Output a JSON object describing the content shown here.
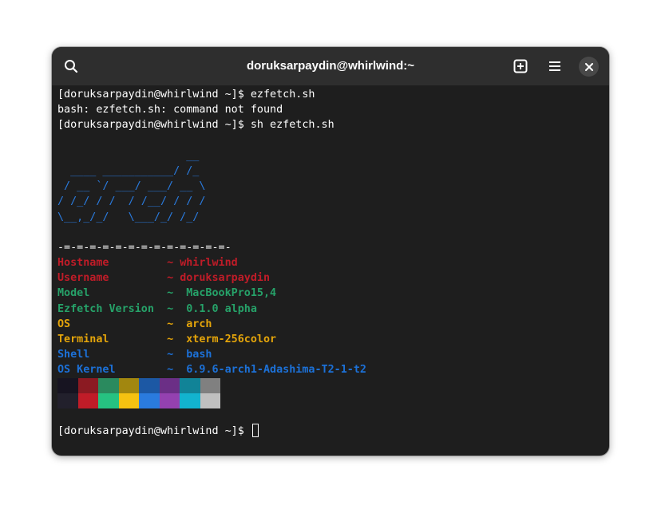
{
  "window": {
    "title": "doruksarpaydin@whirlwind:~"
  },
  "header": {
    "icons": [
      "search-icon",
      "new-tab-icon",
      "menu-icon",
      "close-icon"
    ]
  },
  "terminal": {
    "prompt": "[doruksarpaydin@whirlwind ~]$ ",
    "commands": [
      "ezfetch.sh",
      "sh ezfetch.sh"
    ],
    "error": "bash: ezfetch.sh: command not found",
    "ascii_art": [
      "                    __",
      "  ____ ___________/ /_",
      " / __ `/ ___/ ___/ __ \\",
      "/ /_/ / /  / /__/ / / /",
      "\\__,_/_/   \\___/_/ /_/"
    ],
    "separator": "-=-=-=-=-=-=-=-=-=-=-=-=-=-",
    "info": [
      {
        "label": "Hostname         ",
        "sep": "~ ",
        "value": "whirlwind",
        "color": "red"
      },
      {
        "label": "Username         ",
        "sep": "~ ",
        "value": "doruksarpaydin",
        "color": "red"
      },
      {
        "label": "Model            ",
        "sep": "~  ",
        "value": "MacBookPro15,4",
        "color": "green"
      },
      {
        "label": "Ezfetch Version  ",
        "sep": "~  ",
        "value": "0.1.0 alpha",
        "color": "green"
      },
      {
        "label": "OS               ",
        "sep": "~  ",
        "value": "arch",
        "color": "yellow"
      },
      {
        "label": "Terminal         ",
        "sep": "~  ",
        "value": "xterm-256color",
        "color": "yellow"
      },
      {
        "label": "Shell            ",
        "sep": "~  ",
        "value": "bash",
        "color": "blue"
      },
      {
        "label": "OS Kernel        ",
        "sep": "~  ",
        "value": "6.9.6-arch1-Adashima-T2-1-t2",
        "color": "blue"
      }
    ],
    "palette_normal": [
      "#171421",
      "#8b1a22",
      "#2a8a5e",
      "#a2870f",
      "#1c58a4",
      "#6b2f86",
      "#118397",
      "#808080"
    ],
    "palette_bright": [
      "#22202c",
      "#c01c28",
      "#26c281",
      "#f5c211",
      "#2a7bde",
      "#9441b0",
      "#12b3cf",
      "#c0c0c0"
    ]
  },
  "colors": {
    "red": "#c01c28",
    "green": "#26a269",
    "yellow": "#e5a50a",
    "blue": "#1c71d8",
    "ascii": "#2a7bde",
    "background": "#1e1e1e",
    "header": "#2e2e2e"
  }
}
